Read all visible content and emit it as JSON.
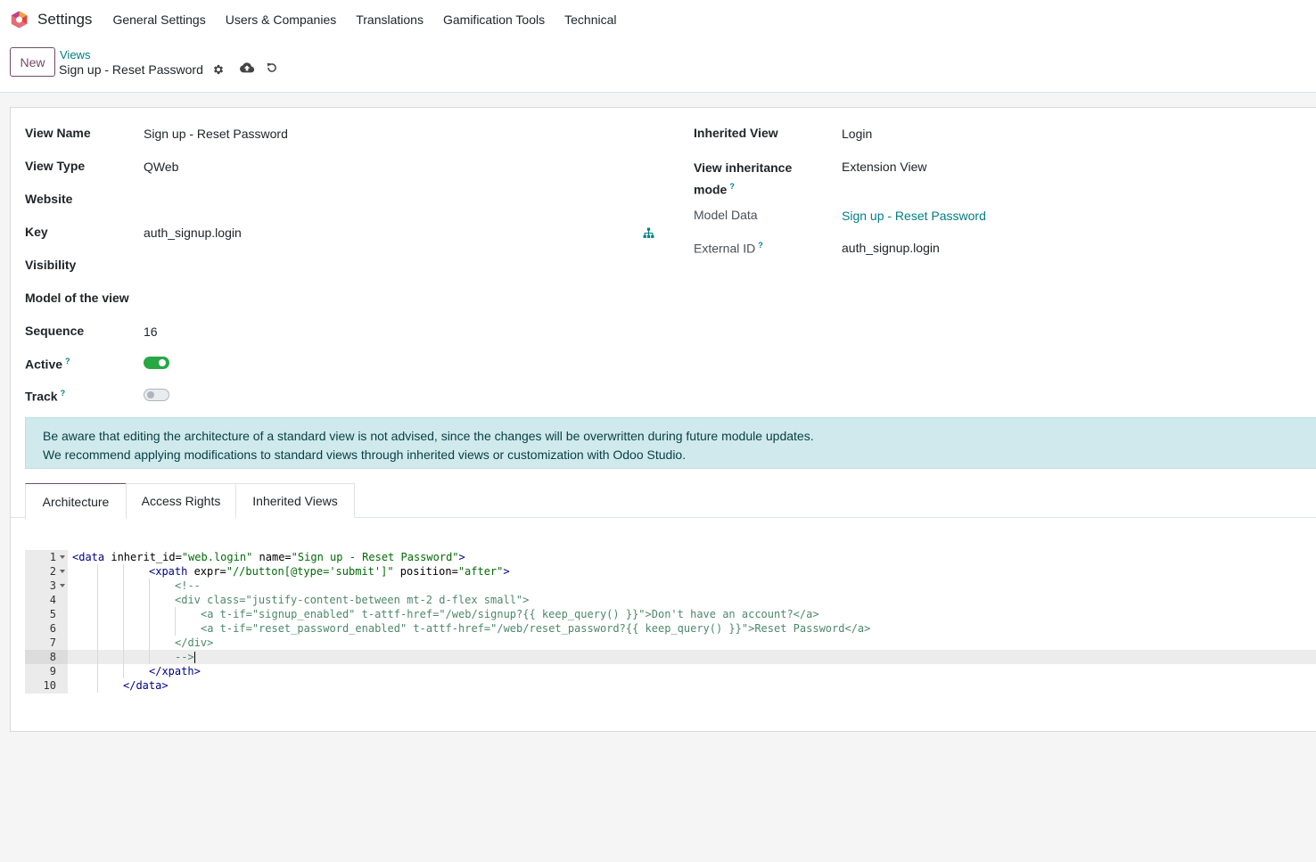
{
  "navbar": {
    "app_title": "Settings",
    "menu": [
      "General Settings",
      "Users & Companies",
      "Translations",
      "Gamification Tools",
      "Technical"
    ]
  },
  "control_panel": {
    "new_label": "New",
    "breadcrumb_parent": "Views",
    "breadcrumb_current": "Sign up - Reset Password",
    "icons": [
      "gear-icon",
      "cloud-upload-icon",
      "undo-icon"
    ]
  },
  "form": {
    "left": [
      {
        "label": "View Name",
        "value": "Sign up - Reset Password"
      },
      {
        "label": "View Type",
        "value": "QWeb"
      },
      {
        "label": "Website",
        "value": ""
      },
      {
        "label": "Key",
        "value": "auth_signup.login"
      },
      {
        "label": "Visibility",
        "value": ""
      },
      {
        "label": "Model of the view",
        "value": ""
      },
      {
        "label": "Sequence",
        "value": "16"
      },
      {
        "label": "Active",
        "value": true,
        "help": "?"
      },
      {
        "label": "Track",
        "value": false,
        "help": "?"
      }
    ],
    "right": [
      {
        "label": "Inherited View",
        "value": "Login"
      },
      {
        "label": "View inheritance",
        "label2": "mode",
        "value": "Extension View",
        "help": "?"
      },
      {
        "label": "Model Data",
        "value": "Sign up - Reset Password"
      },
      {
        "label": "External ID",
        "value": "auth_signup.login",
        "help": "?"
      }
    ]
  },
  "alert": {
    "line1": "Be aware that editing the architecture of a standard view is not advised, since the changes will be overwritten during future module updates.",
    "line2": "We recommend applying modifications to standard views through inherited views or customization with Odoo Studio."
  },
  "tabs": [
    "Architecture",
    "Access Rights",
    "Inherited Views"
  ],
  "code": {
    "active_line": 8,
    "lines": [
      "1",
      "2",
      "3",
      "4",
      "5",
      "6",
      "7",
      "8",
      "9",
      "10"
    ],
    "c1_tag": "<data",
    "c1_a1": " inherit_id=",
    "c1_s1": "\"web.login\"",
    "c1_a2": " name=",
    "c1_s2": "\"Sign up - Reset Password\"",
    "c1_end": ">",
    "c2_tag": "<xpath",
    "c2_a1": " expr=",
    "c2_s1": "\"//button[@type='submit']\"",
    "c2_a2": " position=",
    "c2_s2": "\"after\"",
    "c2_end": ">",
    "c3": "<!--",
    "c4_tag": "<div",
    "c4_a1": " class=",
    "c4_s1": "\"justify-content-between mt-2 d-flex small\"",
    "c4_end": ">",
    "c5_tag": "<a",
    "c5_a1": " t-if=",
    "c5_s1": "\"signup_enabled\"",
    "c5_a2": " t-attf-href=",
    "c5_s2": "\"/web/signup?{{ keep_query() }}\"",
    "c5_text": ">Don't have an account?</a>",
    "c6_tag": "<a",
    "c6_a1": " t-if=",
    "c6_s1": "\"reset_password_enabled\"",
    "c6_a2": " t-attf-href=",
    "c6_s2": "\"/web/reset_password?{{ keep_query() }}\"",
    "c6_text": ">Reset Password</a>",
    "c7": "</div>",
    "c8": "-->",
    "c9": "</xpath>",
    "c10": "</data>"
  },
  "colors": {
    "brand": "#714b67",
    "link": "#017e84",
    "toggle_on": "#28a745",
    "alert_bg": "#cfe9ec"
  }
}
